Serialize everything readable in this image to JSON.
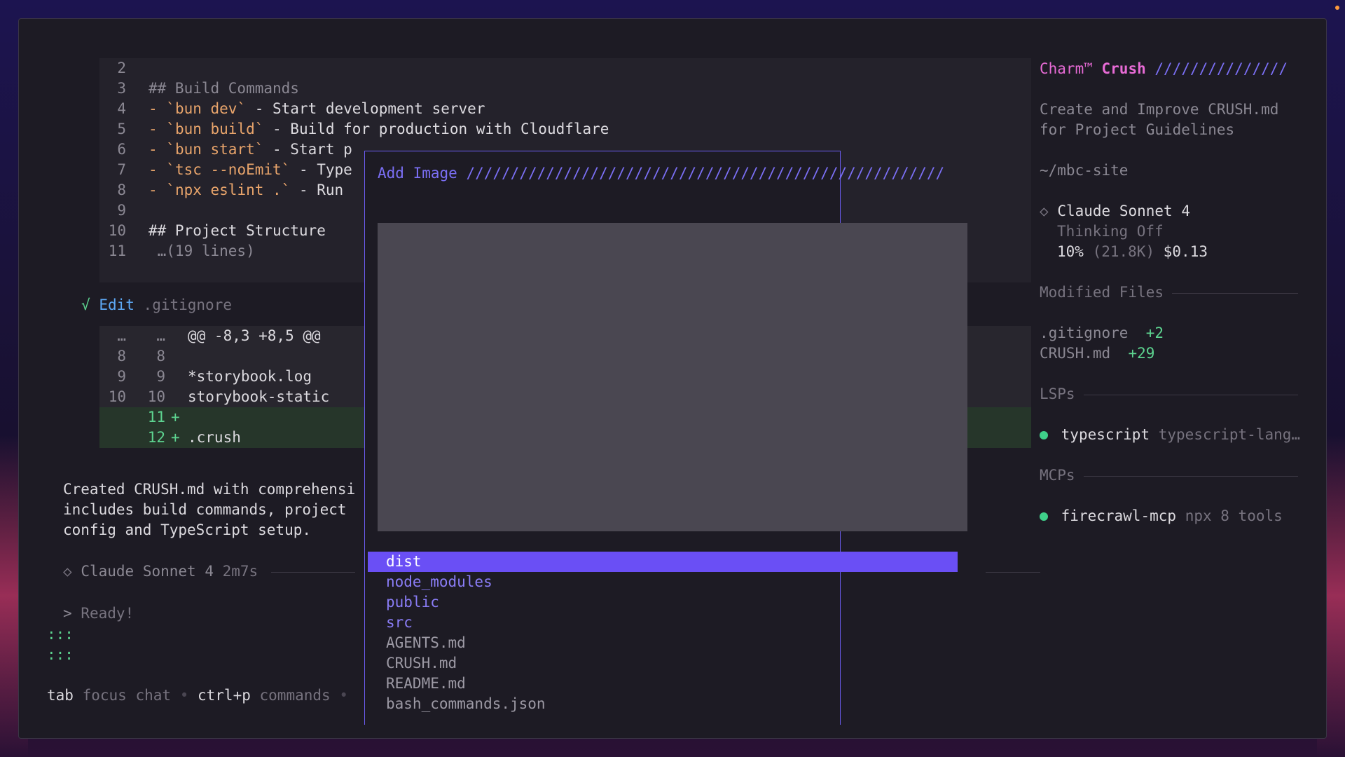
{
  "editor": {
    "lines": [
      {
        "n": "2",
        "segments": []
      },
      {
        "n": "3",
        "segments": [
          {
            "t": "## Build Commands",
            "c": "dim"
          }
        ]
      },
      {
        "n": "4",
        "segments": [
          {
            "t": "- ",
            "c": "orange"
          },
          {
            "t": "`bun dev`",
            "c": "orange"
          },
          {
            "t": " - Start development server",
            "c": ""
          }
        ]
      },
      {
        "n": "5",
        "segments": [
          {
            "t": "- ",
            "c": "orange"
          },
          {
            "t": "`bun build`",
            "c": "orange"
          },
          {
            "t": " - Build for production with Cloudflare",
            "c": ""
          }
        ]
      },
      {
        "n": "6",
        "segments": [
          {
            "t": "- ",
            "c": "orange"
          },
          {
            "t": "`bun start`",
            "c": "orange"
          },
          {
            "t": " - Start p",
            "c": ""
          }
        ]
      },
      {
        "n": "7",
        "segments": [
          {
            "t": "- ",
            "c": "orange"
          },
          {
            "t": "`tsc --noEmit`",
            "c": "orange"
          },
          {
            "t": " - Type",
            "c": ""
          }
        ]
      },
      {
        "n": "8",
        "segments": [
          {
            "t": "- ",
            "c": "orange"
          },
          {
            "t": "`npx eslint .`",
            "c": "orange"
          },
          {
            "t": " - Run",
            "c": ""
          }
        ]
      },
      {
        "n": "9",
        "segments": []
      },
      {
        "n": "10",
        "segments": [
          {
            "t": "## Project Structure",
            "c": ""
          }
        ]
      },
      {
        "n": "11",
        "segments": [
          {
            "t": " …(19 lines)",
            "c": "dim"
          }
        ]
      }
    ]
  },
  "edit_status": {
    "check": "√",
    "action": "Edit",
    "file": ".gitignore"
  },
  "diff": {
    "hunk": {
      "a": "…",
      "b": "…",
      "text": "@@ -8,3 +8,5 @@"
    },
    "rows": [
      {
        "a": "8",
        "b": "8",
        "mark": "",
        "text": ""
      },
      {
        "a": "9",
        "b": "9",
        "mark": "",
        "text": "*storybook.log"
      },
      {
        "a": "10",
        "b": "10",
        "mark": "",
        "text": "storybook-static"
      }
    ],
    "added": [
      {
        "b": "11",
        "mark": "+",
        "text": ""
      },
      {
        "b": "12",
        "mark": "+",
        "text": ".crush"
      }
    ]
  },
  "message": {
    "lines": [
      "Created CRUSH.md with comprehensi",
      "includes build commands, project",
      "config and TypeScript setup."
    ]
  },
  "model_line": {
    "icon": "◇",
    "model": "Claude Sonnet 4",
    "time": "2m7s"
  },
  "prompt": {
    "caret": ">",
    "text": "Ready!",
    "dots": [
      ":::",
      ":::"
    ]
  },
  "help_bar": {
    "items": [
      {
        "key": "tab",
        "desc": "focus chat"
      },
      {
        "key": "ctrl+p",
        "desc": "commands"
      }
    ],
    "sep": "•"
  },
  "dialog": {
    "title": "Add Image",
    "files": [
      {
        "name": "dist",
        "kind": "dir",
        "selected": true
      },
      {
        "name": "node_modules",
        "kind": "dir",
        "selected": false
      },
      {
        "name": "public",
        "kind": "dir",
        "selected": false
      },
      {
        "name": "src",
        "kind": "dir",
        "selected": false
      },
      {
        "name": "AGENTS.md",
        "kind": "file",
        "selected": false
      },
      {
        "name": "CRUSH.md",
        "kind": "file",
        "selected": false
      },
      {
        "name": "README.md",
        "kind": "file",
        "selected": false
      },
      {
        "name": "bash_commands.json",
        "kind": "file",
        "selected": false
      }
    ]
  },
  "sidebar": {
    "brand": "Charm™",
    "product": "Crush",
    "slashes": "///////////////",
    "session_title_lines": [
      "Create and Improve CRUSH.md",
      "for Project Guidelines"
    ],
    "cwd": "~/mbc-site",
    "model": {
      "icon": "◇",
      "name": "Claude Sonnet 4",
      "thinking": "Thinking Off",
      "usage_pct": "10%",
      "tokens": "(21.8K)",
      "cost": "$0.13"
    },
    "modified_files_heading": "Modified Files",
    "modified_files": [
      {
        "name": ".gitignore",
        "delta": "+2"
      },
      {
        "name": "CRUSH.md",
        "delta": "+29"
      }
    ],
    "lsps_heading": "LSPs",
    "lsps": [
      {
        "name": "typescript",
        "detail": "typescript-lang…"
      }
    ],
    "mcps_heading": "MCPs",
    "mcps": [
      {
        "name": "firecrawl-mcp",
        "detail": "npx 8 tools"
      }
    ]
  },
  "colors": {
    "accent": "#6a4ff5",
    "brand": "#e86bd6",
    "ok": "#3fd08a",
    "add": "#5dd490"
  }
}
